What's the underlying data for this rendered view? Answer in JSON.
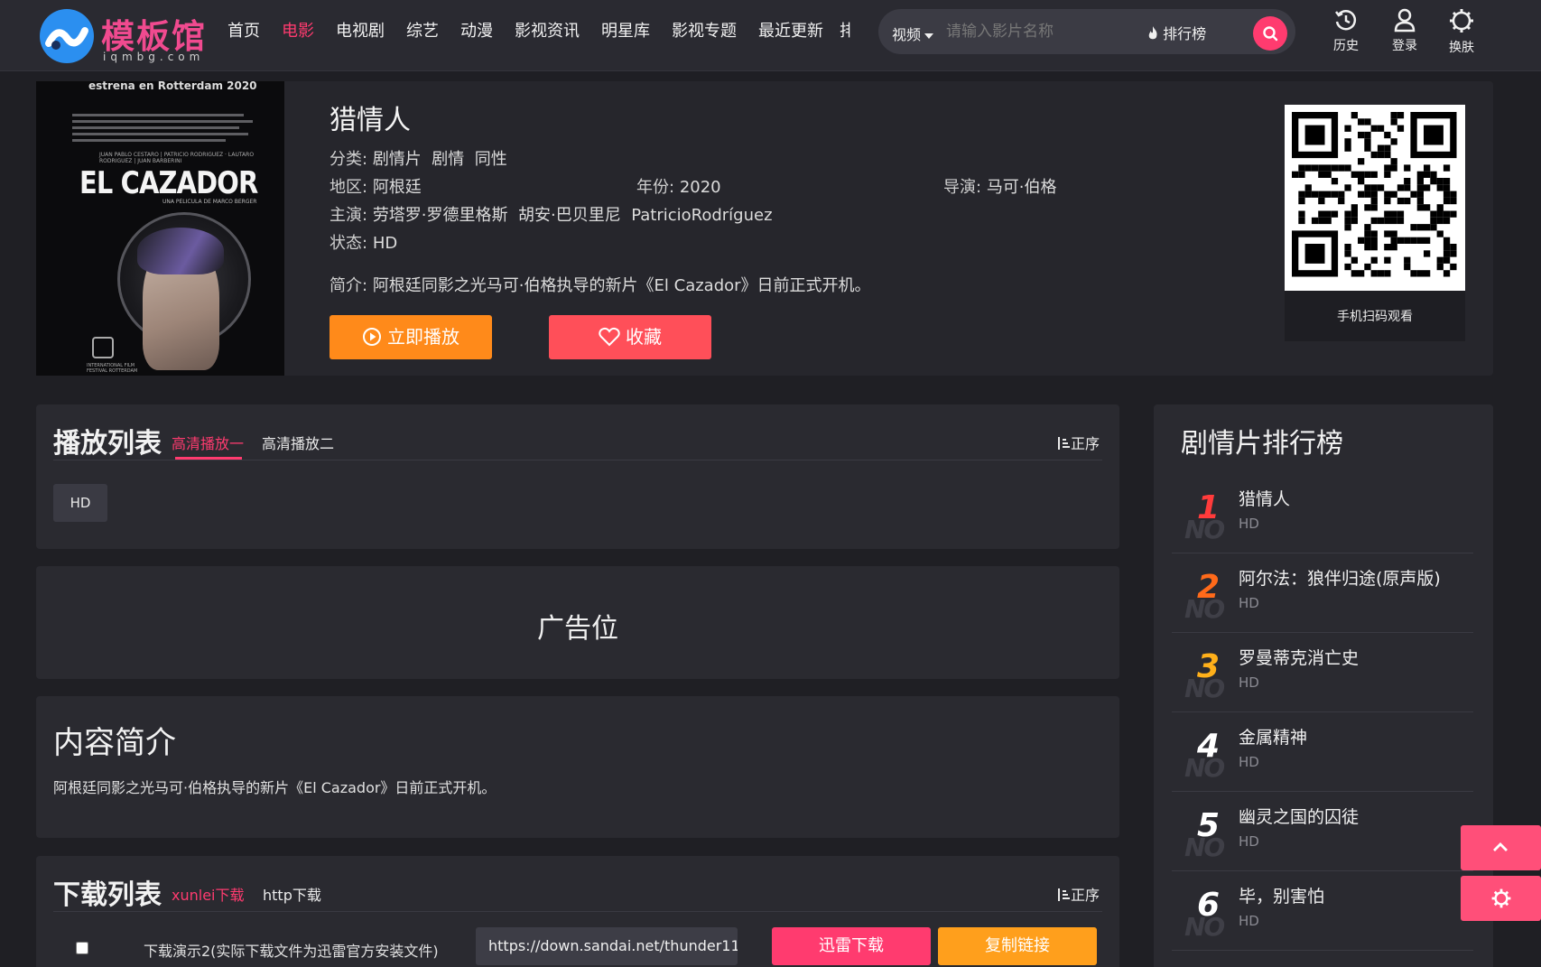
{
  "brand": {
    "name": "模板馆",
    "domain": "iqmbg.com",
    "accent": "#ff3b6f",
    "logo_color": "#2b8ff0"
  },
  "nav": {
    "items": [
      "首页",
      "电影",
      "电视剧",
      "综艺",
      "动漫",
      "影视资讯",
      "明星库",
      "影视专题",
      "最近更新"
    ],
    "active": "电影",
    "overflow": "排"
  },
  "search": {
    "category": "视频",
    "placeholder": "请输入影片名称",
    "rank_link": "排行榜",
    "icon": "search-icon"
  },
  "header_actions": [
    {
      "label": "历史",
      "icon": "history-icon"
    },
    {
      "label": "登录",
      "icon": "user-icon"
    },
    {
      "label": "换肤",
      "icon": "gear-icon"
    }
  ],
  "movie": {
    "title": "猎情人",
    "poster": {
      "top_text": "estrena en Rotterdam 2020",
      "title": "EL CAZADOR",
      "names": "JUAN PABLO CESTARO | PATRICIO RODRIGUEZ · LAUTARO RODRIGUEZ | JUAN BARBERINI",
      "director": "UNA PELICULA DE MARCO BERGER",
      "festival": "INTERNATIONAL FILM FESTIVAL ROTTERDAM"
    },
    "category_label": "分类:",
    "categories": [
      "剧情片",
      "剧情",
      "同性"
    ],
    "region_label": "地区:",
    "region": "阿根廷",
    "year_label": "年份:",
    "year": "2020",
    "director_label": "导演:",
    "director": "马可·伯格",
    "cast_label": "主演:",
    "cast": [
      "劳塔罗·罗德里格斯",
      "胡安·巴贝里尼",
      "PatricioRodríguez"
    ],
    "status_label": "状态:",
    "status": "HD",
    "synopsis_label": "简介:",
    "synopsis": "阿根廷同影之光马可·伯格执导的新片《El Cazador》日前正式开机。",
    "play_button": "立即播放",
    "fav_button": "收藏",
    "qr_caption": "手机扫码观看"
  },
  "playlist": {
    "title": "播放列表",
    "tabs": [
      "高清播放一",
      "高清播放二"
    ],
    "active_tab": 0,
    "sort": "正序",
    "episodes": [
      "HD"
    ]
  },
  "ad": {
    "text": "广告位"
  },
  "intro": {
    "title": "内容简介",
    "text": "阿根廷同影之光马可·伯格执导的新片《El Cazador》日前正式开机。"
  },
  "downloads": {
    "title": "下载列表",
    "tabs": [
      "xunlei下载",
      "http下载"
    ],
    "active_tab": 0,
    "sort": "正序",
    "items": [
      {
        "name": "下载演示2(实际下载文件为迅雷官方安装文件)",
        "url": "https://down.sandai.net/thunder11",
        "primary": "迅雷下载",
        "secondary": "复制链接"
      }
    ]
  },
  "ranking": {
    "title": "剧情片排行榜",
    "no_label": "NO",
    "items": [
      {
        "rank": "1",
        "name": "猎情人",
        "status": "HD",
        "color": "#ff3b3b"
      },
      {
        "rank": "2",
        "name": "阿尔法：狼伴归途(原声版)",
        "status": "HD",
        "color": "#ff6a1a"
      },
      {
        "rank": "3",
        "name": "罗曼蒂克消亡史",
        "status": "HD",
        "color": "#ffb01a"
      },
      {
        "rank": "4",
        "name": "金属精神",
        "status": "HD",
        "color": "#ffffff"
      },
      {
        "rank": "5",
        "name": "幽灵之国的囚徒",
        "status": "HD",
        "color": "#ffffff"
      },
      {
        "rank": "6",
        "name": "毕，别害怕",
        "status": "HD",
        "color": "#ffffff"
      }
    ]
  },
  "floating": [
    {
      "icon": "chevron-up-icon"
    },
    {
      "icon": "gear-icon"
    }
  ]
}
